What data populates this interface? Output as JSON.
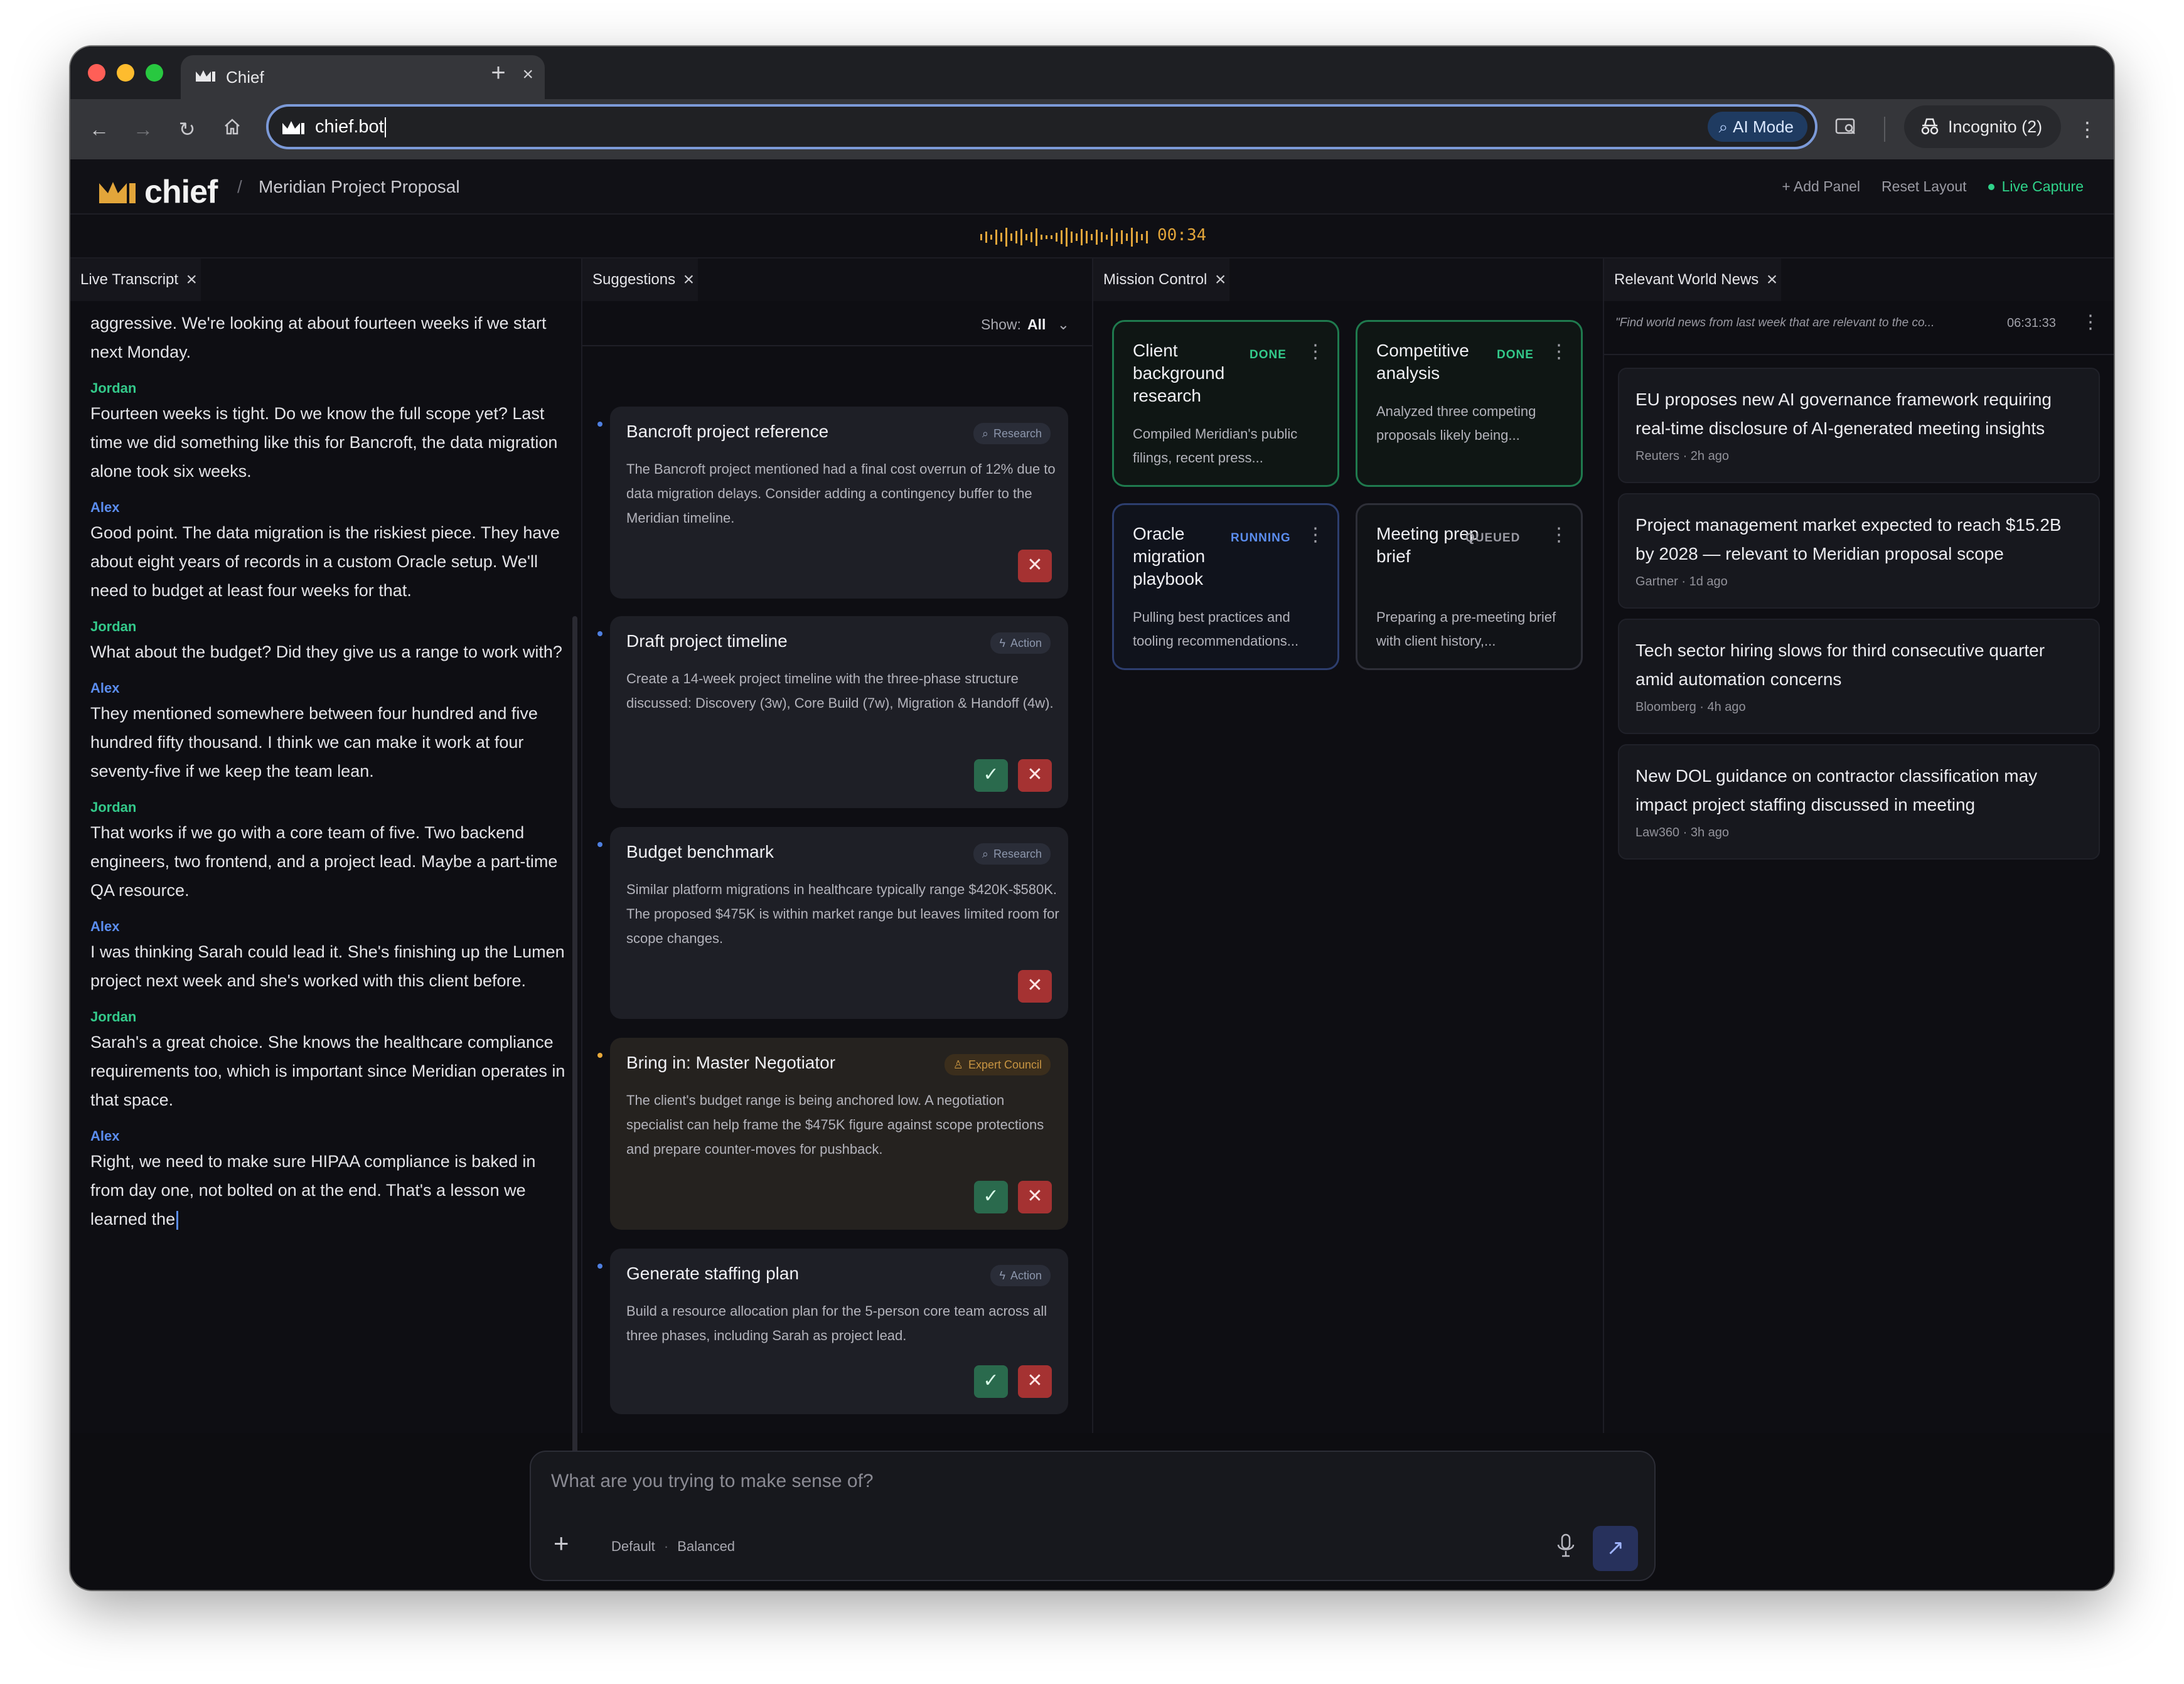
{
  "browser": {
    "tab_title": "Chief",
    "url": "chief.bot",
    "ai_mode_label": "AI Mode",
    "incognito_label": "Incognito (2)"
  },
  "app": {
    "logo_text": "chief",
    "breadcrumb_sep": "/",
    "breadcrumb": "Meridian Project Proposal",
    "actions": {
      "add_panel": "+ Add Panel",
      "reset_layout": "Reset Layout",
      "live_capture": "Live Capture"
    },
    "timer": "00:34",
    "accent_color": "#e2a53a"
  },
  "panels": {
    "transcript": {
      "title": "Live Transcript",
      "lines": [
        {
          "speaker": "",
          "text": "aggressive. We're looking at about fourteen weeks if we start next Monday."
        },
        {
          "speaker": "Jordan",
          "text": "Fourteen weeks is tight. Do we know the full scope yet? Last time we did something like this for Bancroft, the data migration alone took six weeks."
        },
        {
          "speaker": "Alex",
          "text": "Good point. The data migration is the riskiest piece. They have about eight years of records in a custom Oracle setup. We'll need to budget at least four weeks for that."
        },
        {
          "speaker": "Jordan",
          "text": "What about the budget? Did they give us a range to work with?"
        },
        {
          "speaker": "Alex",
          "text": "They mentioned somewhere between four hundred and five hundred fifty thousand. I think we can make it work at four seventy-five if we keep the team lean."
        },
        {
          "speaker": "Jordan",
          "text": "That works if we go with a core team of five. Two backend engineers, two frontend, and a project lead. Maybe a part-time QA resource."
        },
        {
          "speaker": "Alex",
          "text": "I was thinking Sarah could lead it. She's finishing up the Lumen project next week and she's worked with this client before."
        },
        {
          "speaker": "Jordan",
          "text": "Sarah's a great choice. She knows the healthcare compliance requirements too, which is important since Meridian operates in that space."
        },
        {
          "speaker": "Alex",
          "text": "Right, we need to make sure HIPAA compliance is baked in from day one, not bolted on at the end. That's a lesson we learned the"
        }
      ]
    },
    "suggestions": {
      "title": "Suggestions",
      "show_label": "Show:",
      "show_value": "All",
      "items": [
        {
          "title": "Bancroft project reference",
          "tag": "Research",
          "body": "The Bancroft project mentioned had a final cost overrun of 12% due to data migration delays. Consider adding a contingency buffer to the Meridian timeline.",
          "accept": false
        },
        {
          "title": "Draft project timeline",
          "tag": "Action",
          "body": "Create a 14-week project timeline with the three-phase structure discussed: Discovery (3w), Core Build (7w), Migration & Handoff (4w).",
          "accept": true
        },
        {
          "title": "Budget benchmark",
          "tag": "Research",
          "body": "Similar platform migrations in healthcare typically range $420K-$580K. The proposed $475K is within market range but leaves limited room for scope changes.",
          "accept": false
        },
        {
          "title": "Bring in: Master Negotiator",
          "tag": "Expert Council",
          "body": "The client's budget range is being anchored low. A negotiation specialist can help frame the $475K figure against scope protections and prepare counter-moves for pushback.",
          "accept": true
        },
        {
          "title": "Generate staffing plan",
          "tag": "Action",
          "body": "Build a resource allocation plan for the 5-person core team across all three phases, including Sarah as project lead.",
          "accept": true
        }
      ]
    },
    "mission": {
      "title": "Mission Control",
      "cards": [
        {
          "title": "Client background research",
          "status": "DONE",
          "body": "Compiled Meridian's public filings, recent press..."
        },
        {
          "title": "Competitive analysis",
          "status": "DONE",
          "body": "Analyzed three competing proposals likely being..."
        },
        {
          "title": "Oracle migration playbook",
          "status": "RUNNING",
          "body": "Pulling best practices and tooling recommendations..."
        },
        {
          "title": "Meeting prep brief",
          "status": "QUEUED",
          "body": "Preparing a pre-meeting brief with client history,..."
        }
      ]
    },
    "news": {
      "title": "Relevant World News",
      "query": "\"Find world news from last week that are relevant to the co...",
      "query_time": "06:31:33",
      "items": [
        {
          "title": "EU proposes new AI governance framework requiring real-time disclosure of AI-generated meeting insights",
          "meta": "Reuters · 2h ago"
        },
        {
          "title": "Project management market expected to reach $15.2B by 2028 — relevant to Meridian proposal scope",
          "meta": "Gartner · 1d ago"
        },
        {
          "title": "Tech sector hiring slows for third consecutive quarter amid automation concerns",
          "meta": "Bloomberg · 4h ago"
        },
        {
          "title": "New DOL guidance on contractor classification may impact project staffing discussed in meeting",
          "meta": "Law360 · 3h ago"
        }
      ]
    }
  },
  "composer": {
    "placeholder": "What are you trying to make sense of?",
    "mode_default": "Default",
    "mode_sep": "·",
    "mode_balanced": "Balanced"
  }
}
